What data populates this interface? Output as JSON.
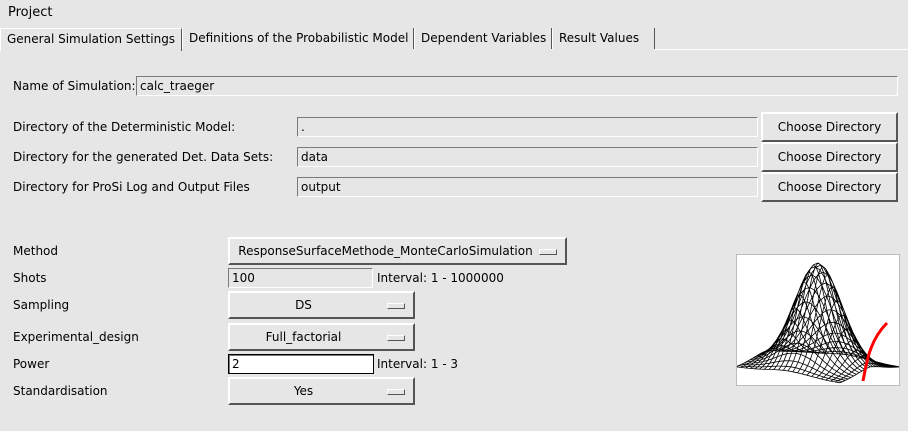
{
  "menubar": {
    "project": "Project"
  },
  "tabs": [
    {
      "label": "General Simulation Settings"
    },
    {
      "label": "Definitions of the Probabilistic Model"
    },
    {
      "label": "Dependent Variables"
    },
    {
      "label": "Result Values"
    }
  ],
  "name": {
    "label": "Name of Simulation:",
    "value": "calc_traeger"
  },
  "dirs": [
    {
      "label": "Directory of the Deterministic Model:",
      "value": ".",
      "button": "Choose Directory"
    },
    {
      "label": "Directory for the generated Det. Data Sets:",
      "value": "data",
      "button": "Choose Directory"
    },
    {
      "label": "Directory for ProSi Log and Output Files",
      "value": "output",
      "button": "Choose Directory"
    }
  ],
  "method": {
    "label": "Method",
    "value": "ResponseSurfaceMethode_MonteCarloSimulation"
  },
  "shots": {
    "label": "Shots",
    "value": "100",
    "interval": "Interval: 1 - 1000000"
  },
  "sampling": {
    "label": "Sampling",
    "value": "DS"
  },
  "experimental_design": {
    "label": "Experimental_design",
    "value": "Full_factorial"
  },
  "power": {
    "label": "Power",
    "value": "2",
    "interval": "Interval: 1 - 3"
  },
  "standardisation": {
    "label": "Standardisation",
    "value": "Yes"
  },
  "colors": {
    "background": "#e6e6e6",
    "surface_line": "#000000",
    "highlight_curve": "#ff0000"
  }
}
